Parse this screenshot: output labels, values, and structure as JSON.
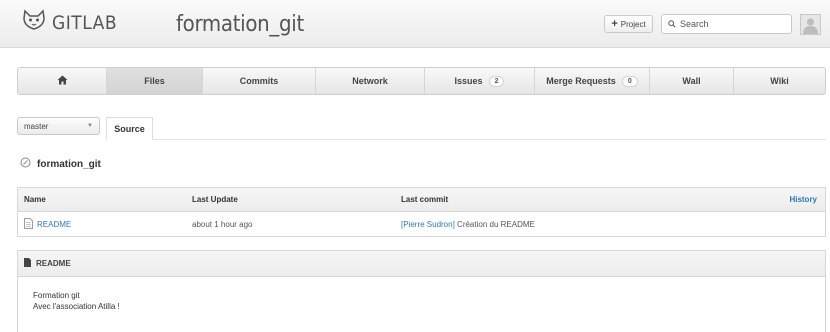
{
  "header": {
    "logo_text": "GITLAB",
    "project_title": "formation_git",
    "new_project_label": "Project",
    "search_placeholder": "Search"
  },
  "nav": {
    "files": "Files",
    "commits": "Commits",
    "network": "Network",
    "issues": "Issues",
    "issues_count": "2",
    "merge_requests": "Merge Requests",
    "merge_requests_count": "0",
    "wall": "Wall",
    "wiki": "Wiki"
  },
  "branch": {
    "selected": "master"
  },
  "tabs": {
    "source": "Source"
  },
  "path": {
    "root": "formation_git"
  },
  "tree": {
    "columns": [
      "Name",
      "Last Update",
      "Last commit",
      "History"
    ],
    "rows": [
      {
        "name": "README",
        "last_update": "about 1 hour ago",
        "commit_author": "[Pierre Sudron]",
        "commit_message": " Création du README"
      }
    ]
  },
  "readme": {
    "title": "README",
    "lines": [
      "Formation git",
      "Avec l'association Atilla !"
    ]
  }
}
